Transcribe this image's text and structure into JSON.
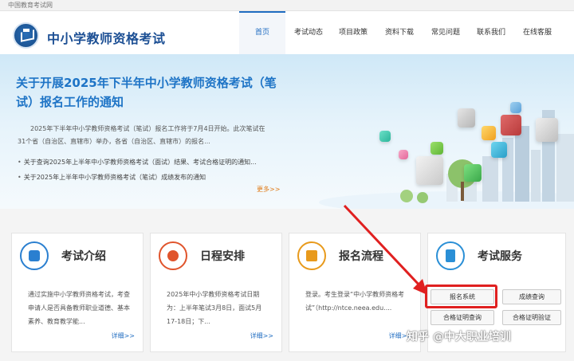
{
  "topbar": {
    "text": "中国教育考试网"
  },
  "header": {
    "site_title": "中小学教师资格考试"
  },
  "nav": [
    {
      "label": "首页",
      "active": true
    },
    {
      "label": "考试动态"
    },
    {
      "label": "项目政策"
    },
    {
      "label": "资料下载"
    },
    {
      "label": "常见问题"
    },
    {
      "label": "联系我们"
    },
    {
      "label": "在线客服"
    }
  ],
  "hero": {
    "title": "关于开展2025年下半年中小学教师资格考试（笔试）报名工作的通知",
    "desc": "2025年下半年中小学教师资格考试（笔试）报名工作将于7月4日开始。此次笔试在31个省（自治区、直辖市）举办，各省（自治区、直辖市）的报名...",
    "items": [
      "关于查询2025年上半年中小学教师资格考试（面试）结果、考试合格证明的通知...",
      "关于2025年上半年中小学教师资格考试（笔试）成绩发布的通知"
    ],
    "more": "更多>>"
  },
  "cards": [
    {
      "title": "考试介绍",
      "text": "通过实施中小学教师资格考试，考查申请人是否具备教师职业道德、基本素养、教育教学能...",
      "detail": "详细>>",
      "icon": "document-icon",
      "color": "#2a7fd0"
    },
    {
      "title": "日程安排",
      "text": "2025年中小学教师资格考试日期为：上半年笔试3月8日，面试5月17-18日；下...",
      "detail": "详细>>",
      "icon": "check-icon",
      "color": "#e0542c"
    },
    {
      "title": "报名流程",
      "text": "登录。考生登录“中小学教师资格考试”（http://ntce.neea.edu....",
      "detail": "详细>>",
      "icon": "form-icon",
      "color": "#e89a1c"
    },
    {
      "title": "考试服务",
      "icon": "service-icon",
      "color": "#2a8fd6"
    }
  ],
  "services": {
    "register": "报名系统",
    "score": "成绩查询",
    "cert_query": "合格证明查询",
    "cert_verify": "合格证明验证"
  },
  "watermark": "知乎 @中大职业培训",
  "colors": {
    "accent": "#1f6cc1",
    "highlight": "#e02020"
  }
}
